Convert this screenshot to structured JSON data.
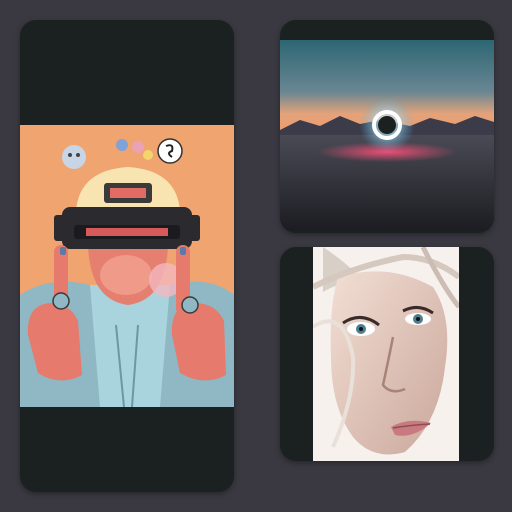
{
  "colors": {
    "background": "#3a3941",
    "card_background": "#1b2120"
  },
  "gallery": {
    "images": [
      {
        "id": "left",
        "icon": "cartoon-vr-headset-image"
      },
      {
        "id": "top-right",
        "icon": "glowing-ring-landscape-image"
      },
      {
        "id": "bottom-right",
        "icon": "face-portrait-image"
      }
    ]
  }
}
